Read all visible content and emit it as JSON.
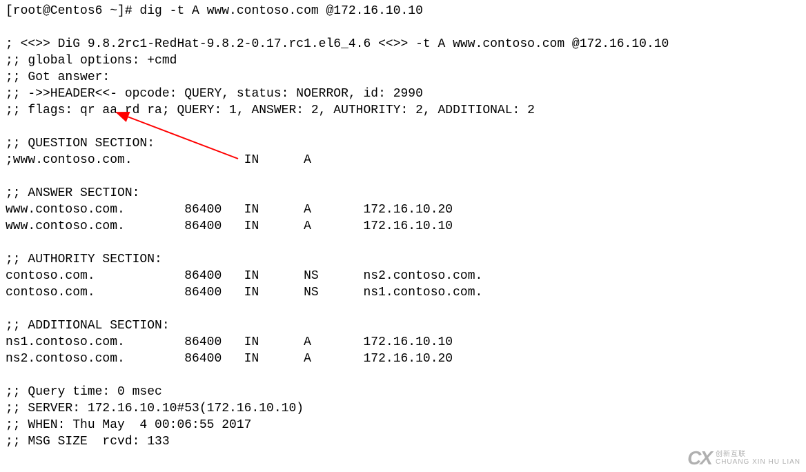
{
  "terminal": {
    "prompt_line": "[root@Centos6 ~]# dig -t A www.contoso.com @172.16.10.10",
    "blank1": "",
    "dig_banner": "; <<>> DiG 9.8.2rc1-RedHat-9.8.2-0.17.rc1.el6_4.6 <<>> -t A www.contoso.com @172.16.10.10",
    "global_opts": ";; global options: +cmd",
    "got_answer": ";; Got answer:",
    "header_line": ";; ->>HEADER<<- opcode: QUERY, status: NOERROR, id: 2990",
    "flags_line": ";; flags: qr aa rd ra; QUERY: 1, ANSWER: 2, AUTHORITY: 2, ADDITIONAL: 2",
    "blank2": "",
    "question_hdr": ";; QUESTION SECTION:",
    "question_row": ";www.contoso.com.               IN      A",
    "blank3": "",
    "answer_hdr": ";; ANSWER SECTION:",
    "answer_row1": "www.contoso.com.        86400   IN      A       172.16.10.20",
    "answer_row2": "www.contoso.com.        86400   IN      A       172.16.10.10",
    "blank4": "",
    "authority_hdr": ";; AUTHORITY SECTION:",
    "authority_row1": "contoso.com.            86400   IN      NS      ns2.contoso.com.",
    "authority_row2": "contoso.com.            86400   IN      NS      ns1.contoso.com.",
    "blank5": "",
    "additional_hdr": ";; ADDITIONAL SECTION:",
    "additional_row1": "ns1.contoso.com.        86400   IN      A       172.16.10.10",
    "additional_row2": "ns2.contoso.com.        86400   IN      A       172.16.10.20",
    "blank6": "",
    "query_time": ";; Query time: 0 msec",
    "server_line": ";; SERVER: 172.16.10.10#53(172.16.10.10)",
    "when_line": ";; WHEN: Thu May  4 00:06:55 2017",
    "msg_size": ";; MSG SIZE  rcvd: 133"
  },
  "annotation": {
    "arrow_color": "#ff0000"
  },
  "watermark": {
    "logo_text": "CX",
    "text_cn": "创新互联",
    "text_en": "CHUANG XIN HU LIAN"
  }
}
